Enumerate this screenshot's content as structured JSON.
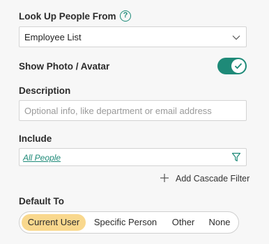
{
  "lookup": {
    "label": "Look Up People From",
    "help_icon": "question-circle-icon",
    "selected": "Employee List"
  },
  "photo": {
    "label": "Show Photo / Avatar",
    "enabled": true
  },
  "description": {
    "label": "Description",
    "placeholder": "Optional info, like department or email address"
  },
  "include": {
    "label": "Include",
    "filter_value": "All People",
    "filter_icon": "funnel-icon",
    "cascade_label": "Add Cascade Filter"
  },
  "default_to": {
    "label": "Default To",
    "options": [
      "Current User",
      "Specific Person",
      "Other",
      "None"
    ],
    "selected": "Current User"
  },
  "colors": {
    "accent": "#1e8a78",
    "selected_segment": "#f9d88e",
    "background": "#f7f7f7"
  }
}
